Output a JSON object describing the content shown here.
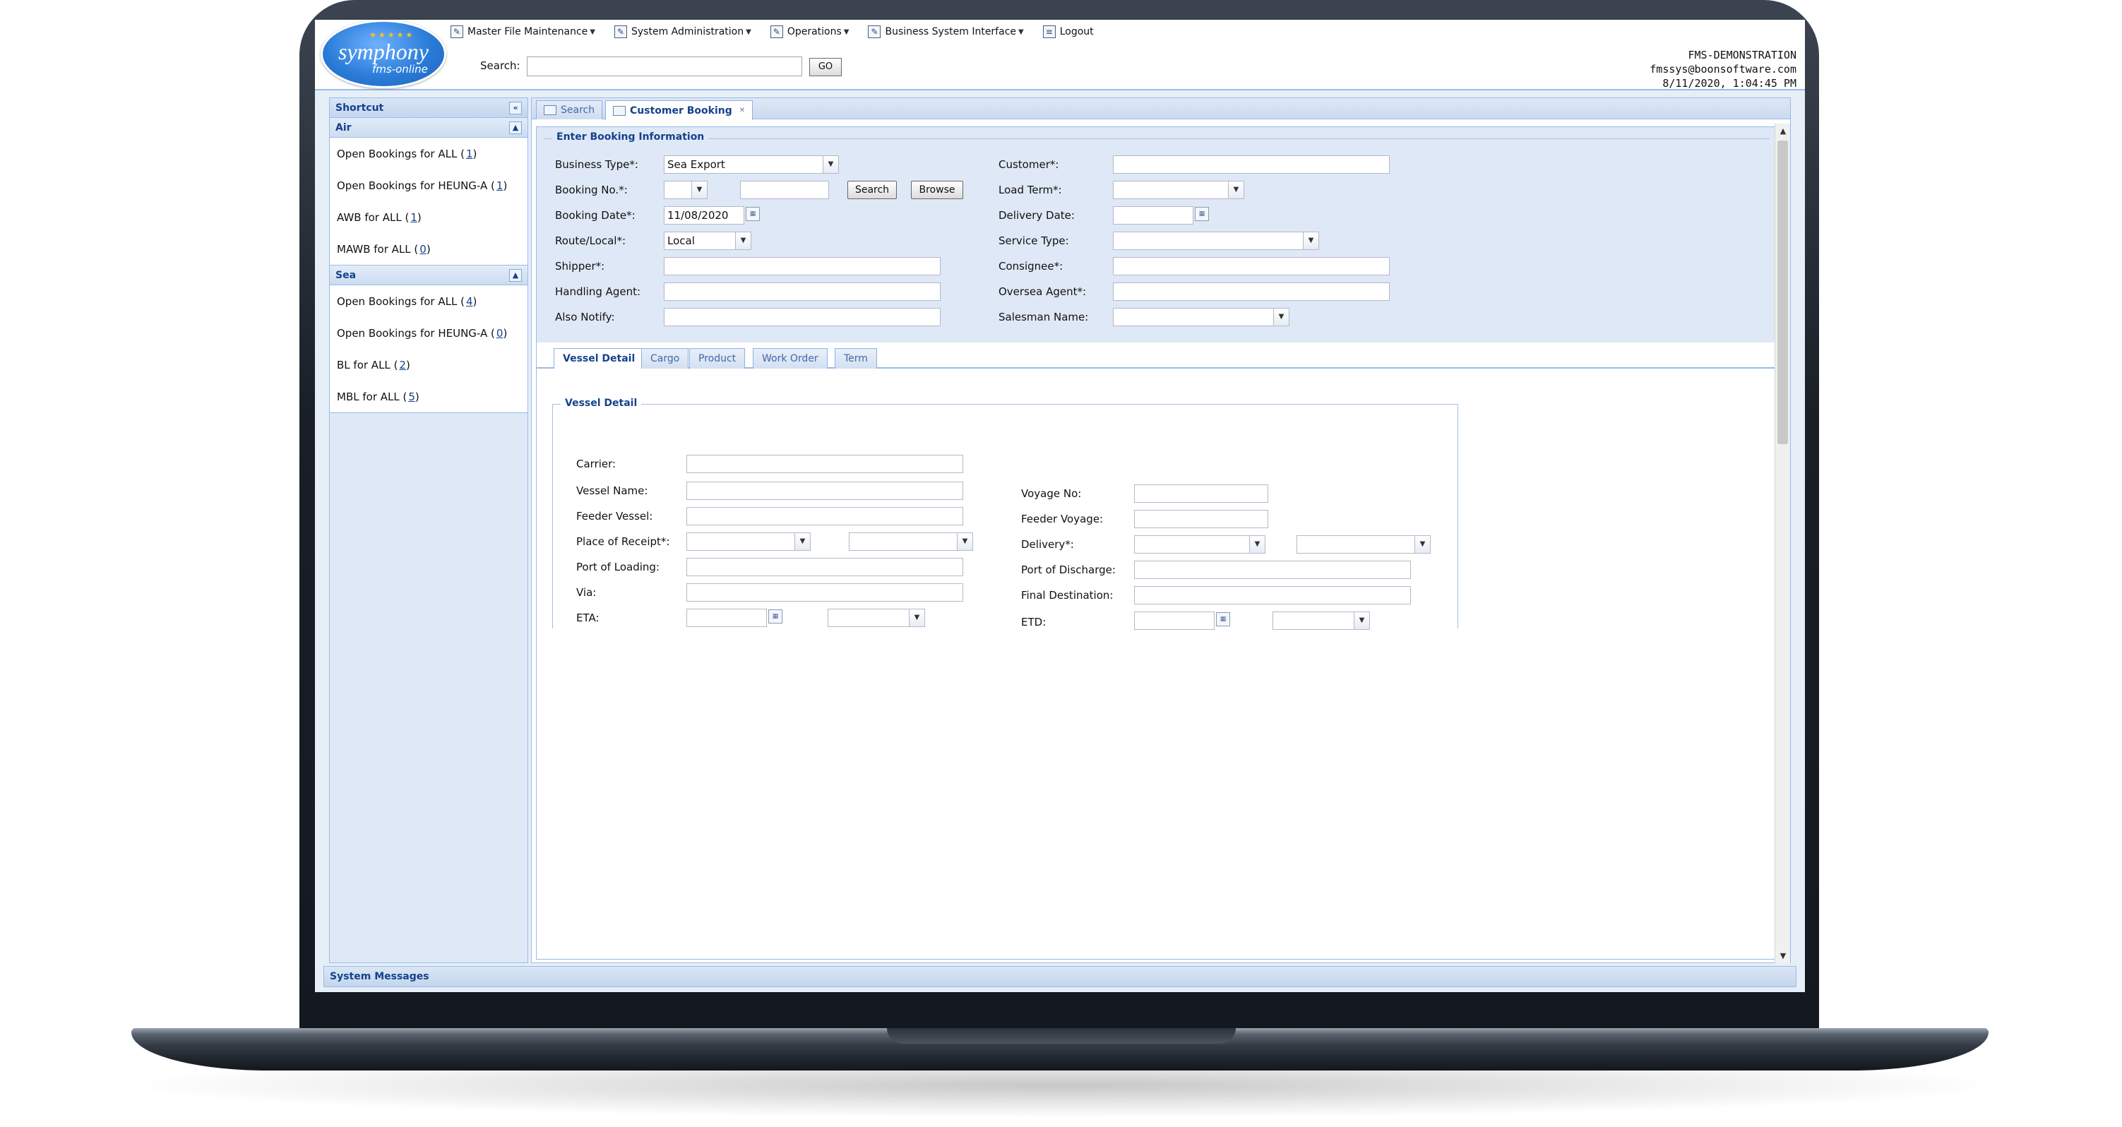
{
  "logo": {
    "main": "symphony",
    "sub": "fms-online"
  },
  "menu": [
    {
      "label": "Master File Maintenance",
      "icon": "document-icon",
      "dropdown": true
    },
    {
      "label": "System Administration",
      "icon": "document-icon",
      "dropdown": true
    },
    {
      "label": "Operations",
      "icon": "document-icon",
      "dropdown": true
    },
    {
      "label": "Business System Interface",
      "icon": "document-icon",
      "dropdown": true
    },
    {
      "label": "Logout",
      "icon": "logout-icon",
      "dropdown": false
    }
  ],
  "search": {
    "label": "Search:",
    "value": "",
    "go_label": "GO"
  },
  "user": {
    "company": "FMS-DEMONSTRATION",
    "email": "fmssys@boonsoftware.com",
    "datetime": "8/11/2020, 1:04:45 PM"
  },
  "sidebar": {
    "title": "Shortcut",
    "groups": [
      {
        "title": "Air",
        "items": [
          {
            "label": "Open Bookings for ALL",
            "count": "1"
          },
          {
            "label": "Open Bookings for HEUNG-A",
            "count": "1"
          },
          {
            "label": "AWB for ALL",
            "count": "1"
          },
          {
            "label": "MAWB for ALL",
            "count": "0"
          }
        ]
      },
      {
        "title": "Sea",
        "items": [
          {
            "label": "Open Bookings for ALL",
            "count": "4"
          },
          {
            "label": "Open Bookings for HEUNG-A",
            "count": "0"
          },
          {
            "label": "BL for ALL",
            "count": "2"
          },
          {
            "label": "MBL for ALL",
            "count": "5"
          }
        ]
      }
    ]
  },
  "main_tabs": [
    {
      "label": "Search"
    },
    {
      "label": "Customer Booking"
    }
  ],
  "booking": {
    "legend": "Enter Booking Information",
    "business_type": {
      "label": "Business Type*:",
      "value": "Sea Export"
    },
    "booking_no": {
      "label": "Booking No.*:",
      "prefix": "",
      "value": "",
      "search_label": "Search",
      "browse_label": "Browse"
    },
    "booking_date": {
      "label": "Booking Date*:",
      "value": "11/08/2020"
    },
    "route_local": {
      "label": "Route/Local*:",
      "value": "Local"
    },
    "shipper": {
      "label": "Shipper*:",
      "value": ""
    },
    "handling_agent": {
      "label": "Handling Agent:",
      "value": ""
    },
    "also_notify": {
      "label": "Also Notify:",
      "value": ""
    },
    "customer": {
      "label": "Customer*:",
      "value": ""
    },
    "load_term": {
      "label": "Load Term*:",
      "value": ""
    },
    "delivery_date": {
      "label": "Delivery Date:",
      "value": ""
    },
    "service_type": {
      "label": "Service Type:",
      "value": ""
    },
    "consignee": {
      "label": "Consignee*:",
      "value": ""
    },
    "oversea_agent": {
      "label": "Oversea Agent*:",
      "value": ""
    },
    "salesman_name": {
      "label": "Salesman Name:",
      "value": ""
    }
  },
  "sub_tabs": [
    {
      "label": "Vessel Detail"
    },
    {
      "label": "Cargo"
    },
    {
      "label": "Product"
    },
    {
      "label": "Work Order"
    },
    {
      "label": "Term"
    }
  ],
  "vessel": {
    "legend": "Vessel Detail",
    "carrier": {
      "label": "Carrier:",
      "value": ""
    },
    "vessel_name": {
      "label": "Vessel Name:",
      "value": ""
    },
    "feeder_vessel": {
      "label": "Feeder Vessel:",
      "value": ""
    },
    "place_of_receipt": {
      "label": "Place of Receipt*:",
      "value": "",
      "value2": ""
    },
    "port_of_loading": {
      "label": "Port of Loading:",
      "value": ""
    },
    "via": {
      "label": "Via:",
      "value": ""
    },
    "eta": {
      "label": "ETA:",
      "value": "",
      "time": ""
    },
    "voyage_no": {
      "label": "Voyage No:",
      "value": ""
    },
    "feeder_voyage": {
      "label": "Feeder Voyage:",
      "value": ""
    },
    "delivery": {
      "label": "Delivery*:",
      "value": "",
      "value2": ""
    },
    "port_of_discharge": {
      "label": "Port of Discharge:",
      "value": ""
    },
    "final_destination": {
      "label": "Final Destination:",
      "value": ""
    },
    "etd": {
      "label": "ETD:",
      "value": "",
      "time": ""
    }
  },
  "footer": {
    "system_messages": "System Messages"
  }
}
